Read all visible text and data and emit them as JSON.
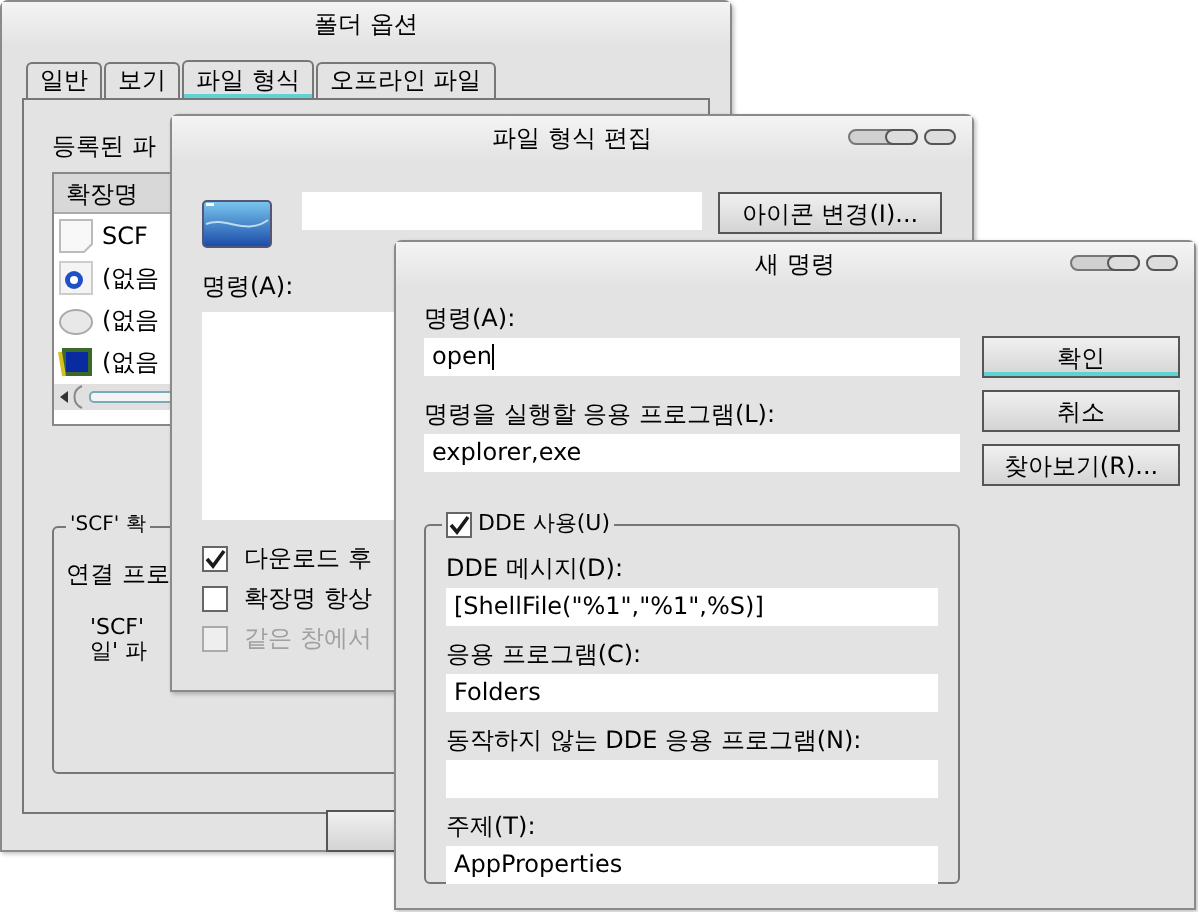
{
  "folder_options": {
    "title": "폴더 옵션",
    "tabs": [
      {
        "label": "일반",
        "selected": false
      },
      {
        "label": "보기",
        "selected": false
      },
      {
        "label": "파일 형식",
        "selected": true
      },
      {
        "label": "오프라인 파일",
        "selected": false
      }
    ],
    "registered_label": "등록된 파",
    "list_header": "확장명",
    "list_rows": [
      "SCF",
      "(없음",
      "(없음",
      "(없음"
    ],
    "group_title": "'SCF' 확",
    "linked_label": "연결 프로",
    "details": [
      "'SCF'",
      "일' 파"
    ]
  },
  "edit_file_type": {
    "title": "파일 형식 편집",
    "change_icon_button": "아이콘 변경(I)...",
    "command_label": "명령(A):",
    "options": [
      {
        "label": "다운로드 후",
        "checked": true,
        "disabled": false
      },
      {
        "label": "확장명 항상",
        "checked": false,
        "disabled": false
      },
      {
        "label": "같은 창에서",
        "checked": false,
        "disabled": true
      }
    ]
  },
  "new_command": {
    "title": "새 명령",
    "fields": [
      {
        "label": "명령(A):",
        "value": "open",
        "focused": true
      },
      {
        "label": "명령을 실행할 응용 프로그램(L):",
        "value": "explorer,exe",
        "focused": false
      }
    ],
    "buttons": [
      {
        "label": "확인",
        "default": true
      },
      {
        "label": "취소",
        "default": false
      },
      {
        "label": "찾아보기(R)...",
        "default": false
      }
    ],
    "dde": {
      "label": "DDE 사용(U)",
      "checked": true,
      "fields": [
        {
          "label": "DDE 메시지(D):",
          "value": "[ShellFile(\"%1\",\"%1\",%S)]"
        },
        {
          "label": "응용 프로그램(C):",
          "value": "Folders"
        },
        {
          "label": "동작하지 않는 DDE 응용 프로그램(N):"
        },
        {
          "label": "주제(T):",
          "value": "AppProperties"
        }
      ]
    }
  }
}
